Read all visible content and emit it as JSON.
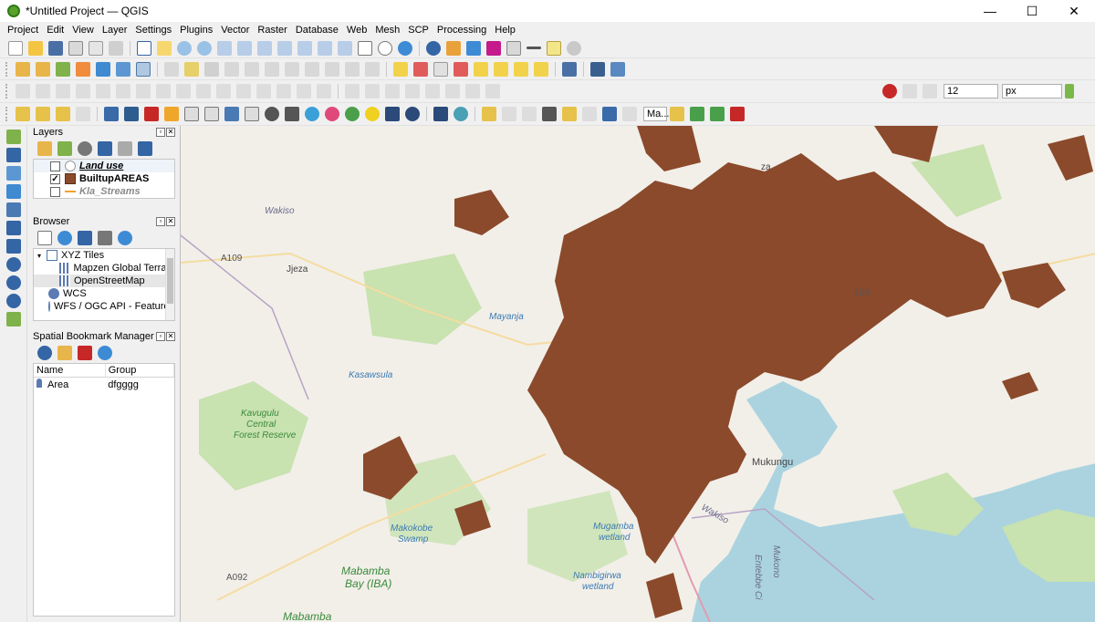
{
  "window": {
    "title": "*Untitled Project — QGIS",
    "minimize": "—",
    "maximize": "☐",
    "close": "✕"
  },
  "menu": [
    "Project",
    "Edit",
    "View",
    "Layer",
    "Settings",
    "Plugins",
    "Vector",
    "Raster",
    "Database",
    "Web",
    "Mesh",
    "SCP",
    "Processing",
    "Help"
  ],
  "digitizing": {
    "tolerance": "12",
    "unit": "px"
  },
  "label_combo": "Ma...",
  "layers_panel": {
    "title": "Layers",
    "items": [
      {
        "label": "Land use",
        "checked": false,
        "style": "bold-italic-underline"
      },
      {
        "label": "BuiltupAREAS",
        "checked": true,
        "style": "bold",
        "color": "#8b4a2b"
      },
      {
        "label": "Kla_Streams",
        "checked": false,
        "style": "bold-italic-gray",
        "color": "#f0a030"
      }
    ]
  },
  "browser_panel": {
    "title": "Browser",
    "items": [
      {
        "label": "XYZ Tiles",
        "level": 0,
        "icon": "xyz-tiles-icon",
        "expanded": true
      },
      {
        "label": "Mapzen Global Terrain",
        "level": 1,
        "icon": "grid-icon"
      },
      {
        "label": "OpenStreetMap",
        "level": 1,
        "icon": "grid-icon",
        "selected": true
      },
      {
        "label": "WCS",
        "level": 0,
        "icon": "wcs-icon"
      },
      {
        "label": "WFS / OGC API - Features",
        "level": 0,
        "icon": "wfs-icon"
      }
    ]
  },
  "bookmarks_panel": {
    "title": "Spatial Bookmark Manager",
    "columns": [
      "Name",
      "Group"
    ],
    "rows": [
      {
        "name": "Area",
        "group": "dfgggg"
      }
    ]
  },
  "map_labels": [
    "Wakiso",
    "A109",
    "Jjeza",
    "Mayanja",
    "Kasawsula",
    "Kavugulu",
    "Central",
    "Forest Reserve",
    "Makokobe",
    "Swamp",
    "Mabamba",
    "Bay (IBA)",
    "Mugamba",
    "wetland",
    "Nambigirwa",
    "wetland",
    "Mukono",
    "Entebbe Ci",
    "Wakiso",
    "Mukungu",
    "A092",
    "Mabamba",
    "109",
    "za"
  ],
  "colors": {
    "builtup": "#8b4a2b",
    "water": "#aad3df",
    "forest": "#c8e2b0",
    "background": "#f2efe9"
  }
}
